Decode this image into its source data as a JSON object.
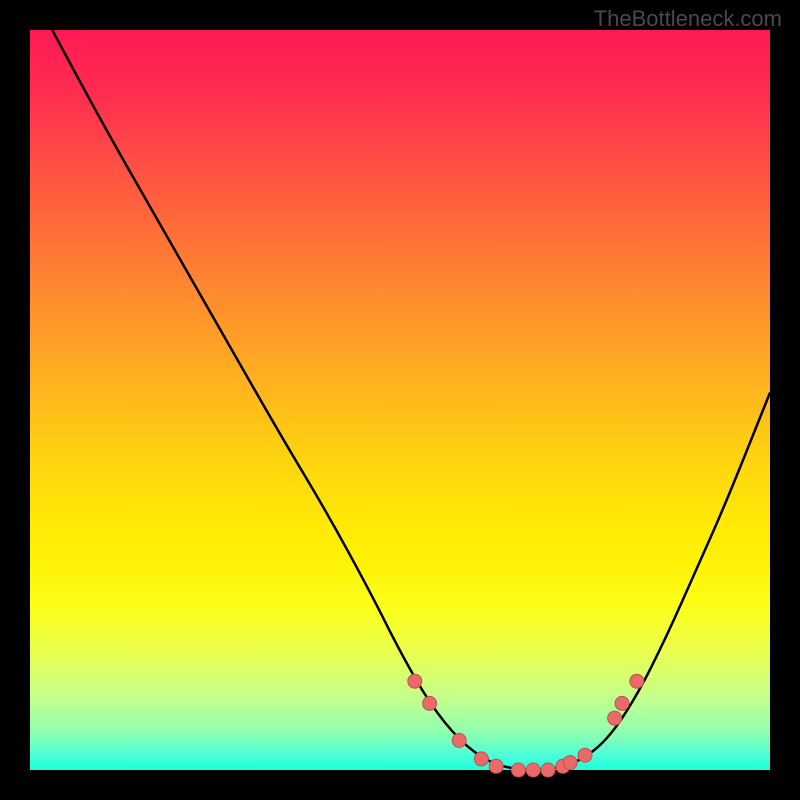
{
  "watermark": "TheBottleneck.com",
  "colors": {
    "curve_stroke": "#000000",
    "marker_fill": "#e86a6a",
    "marker_stroke": "#c94f4f"
  },
  "chart_data": {
    "type": "line",
    "title": "",
    "xlabel": "",
    "ylabel": "",
    "xlim": [
      0,
      100
    ],
    "ylim": [
      0,
      100
    ],
    "series": [
      {
        "name": "bottleneck-curve",
        "x": [
          3,
          10,
          18,
          26,
          34,
          40,
          46,
          50,
          54,
          58,
          62,
          66,
          70,
          74,
          78,
          82,
          86,
          90,
          94,
          100
        ],
        "y": [
          100,
          87,
          73,
          59,
          45,
          35,
          24,
          16,
          9,
          4,
          1,
          0,
          0,
          1,
          4,
          10,
          18,
          27,
          36,
          51
        ]
      }
    ],
    "markers": {
      "name": "highlight-points",
      "x": [
        52,
        54,
        58,
        61,
        63,
        66,
        68,
        70,
        72,
        73,
        75,
        79,
        80,
        82
      ],
      "y": [
        12,
        9,
        4,
        1.5,
        0.5,
        0,
        0,
        0,
        0.5,
        1,
        2,
        7,
        9,
        12
      ]
    }
  }
}
